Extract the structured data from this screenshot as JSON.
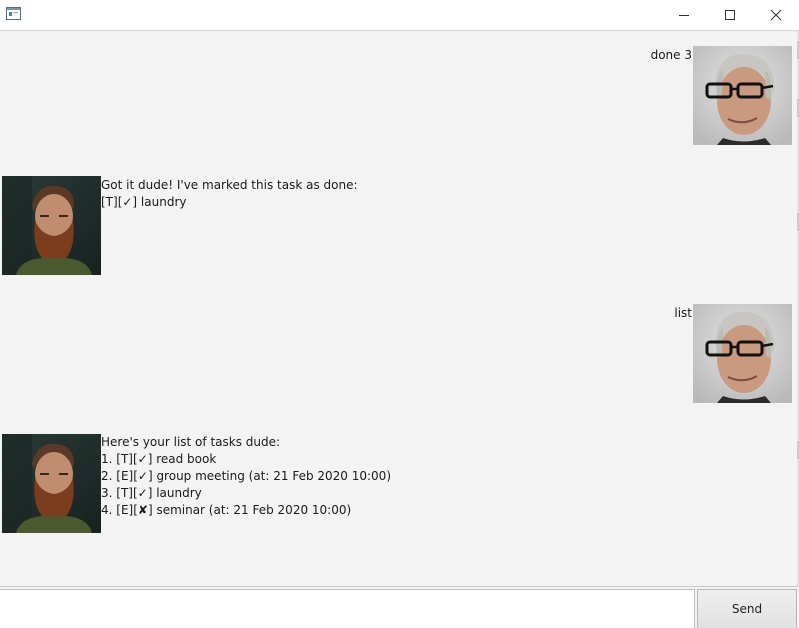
{
  "titlebar": {
    "icons": [
      "app-icon",
      "minimize-icon",
      "maximize-icon",
      "close-icon"
    ]
  },
  "chat": {
    "messages": [
      {
        "sender": "user",
        "avatar": "user-avatar-gray-haired-man-glasses",
        "lines": [
          "done 3"
        ]
      },
      {
        "sender": "bot",
        "avatar": "bot-avatar-bearded-man",
        "lines": [
          "Got it dude! I've marked this task as done:",
          "[T][✓] laundry"
        ]
      },
      {
        "sender": "user",
        "avatar": "user-avatar-gray-haired-man-glasses",
        "lines": [
          "list"
        ]
      },
      {
        "sender": "bot",
        "avatar": "bot-avatar-bearded-man",
        "lines": [
          "Here's your list of tasks dude:",
          "1. [T][✓] read book",
          "2. [E][✓] group meeting (at: 21 Feb 2020 10:00)",
          "3. [T][✓] laundry",
          "4. [E][✘] seminar (at: 21 Feb 2020 10:00)"
        ]
      }
    ]
  },
  "input": {
    "value": "",
    "placeholder": ""
  },
  "send_button": {
    "label": "Send"
  }
}
